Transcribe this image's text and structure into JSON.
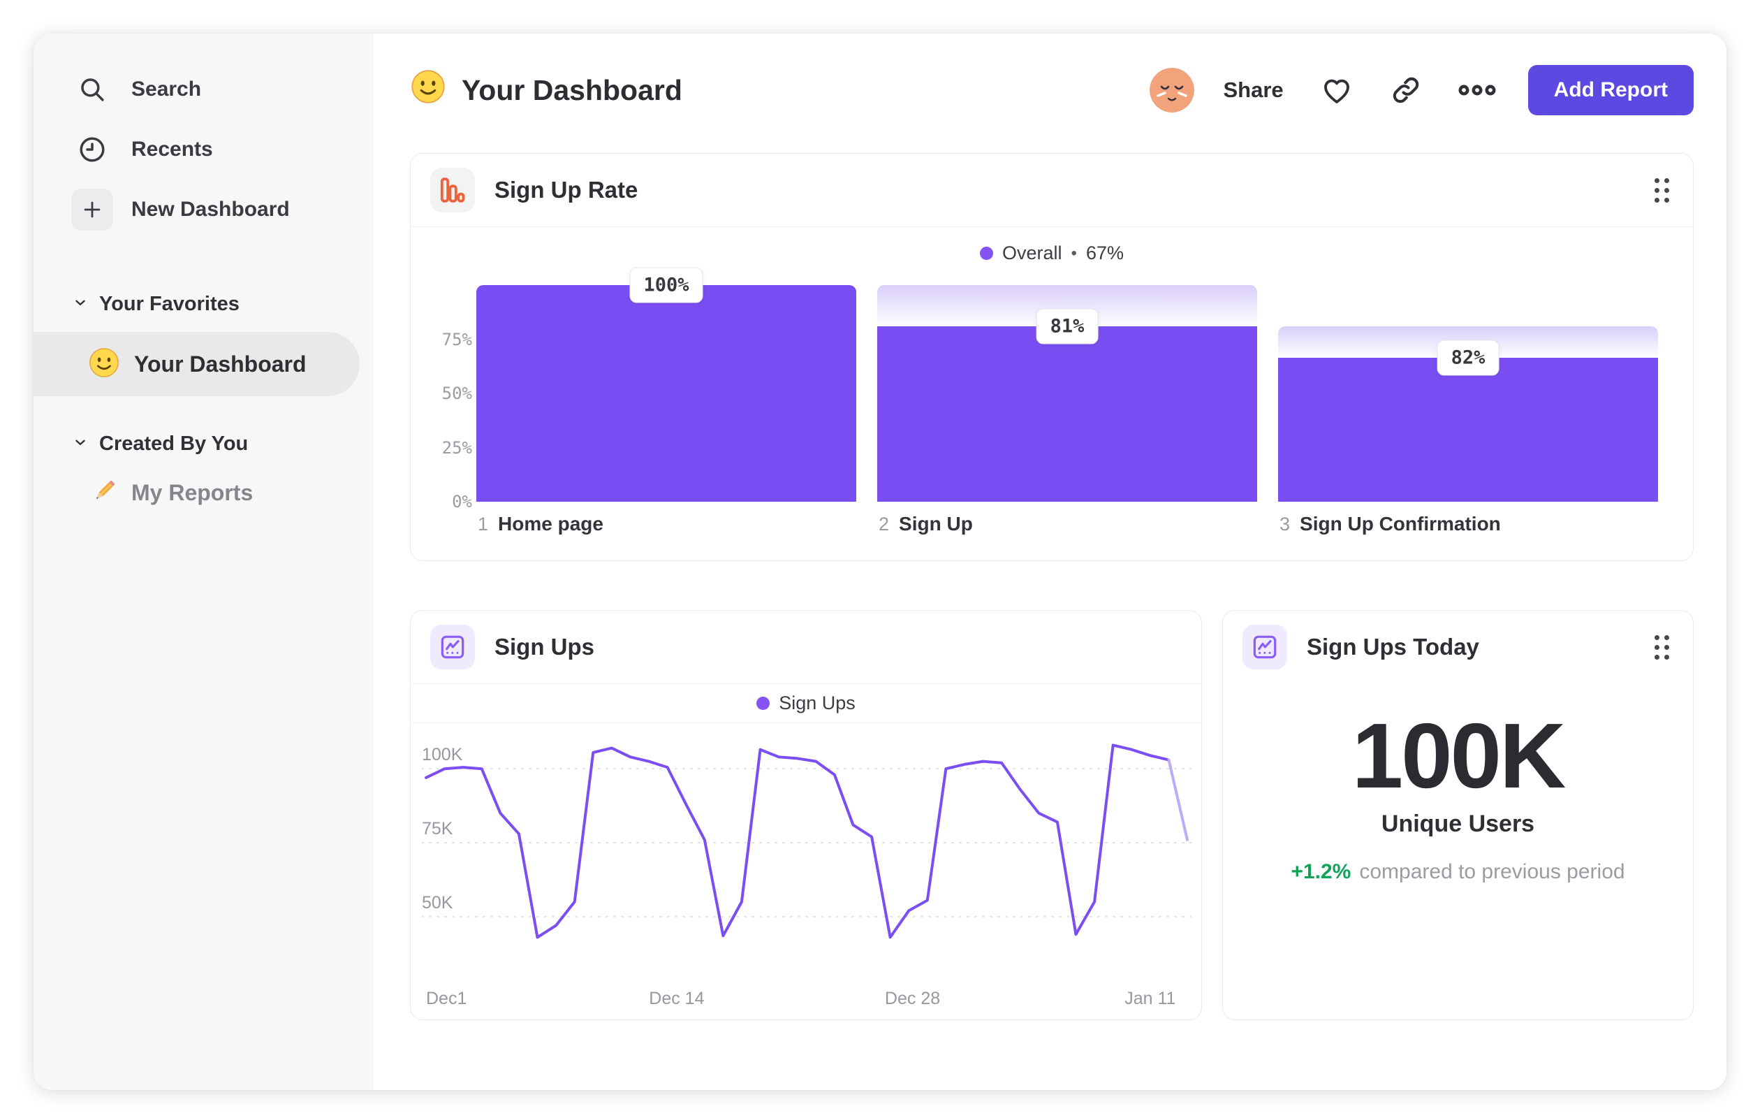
{
  "theme": {
    "accent_purple": "#7a4ef2",
    "legend_dot": "#8552f5",
    "button_indigo": "#5b49e2",
    "positive_green": "#0fa35a",
    "funnel_icon_orange": "#ee6239",
    "line_icon_purple": "#8b5cf6",
    "ghost_gradient_top": "#d9cffa",
    "faded_line": "#bfaaf7"
  },
  "sidebar": {
    "items": [
      {
        "icon": "search-icon",
        "label": "Search"
      },
      {
        "icon": "clock-icon",
        "label": "Recents"
      },
      {
        "icon": "plus-icon",
        "label": "New Dashboard"
      }
    ],
    "favorites": {
      "label": "Your Favorites",
      "item": {
        "emoji": "smiley-emoji",
        "label": "Your Dashboard"
      }
    },
    "created": {
      "label": "Created By You",
      "item": {
        "emoji": "pencil-emoji",
        "label": "My Reports"
      }
    }
  },
  "header": {
    "title": "Your Dashboard",
    "share_label": "Share",
    "add_report_label": "Add Report"
  },
  "cards": {
    "funnel": {
      "title": "Sign Up Rate",
      "legend": {
        "name": "Overall",
        "separator": "•",
        "value": "67%"
      }
    },
    "line": {
      "title": "Sign Ups",
      "legend": {
        "name": "Sign Ups"
      }
    },
    "stat": {
      "title": "Sign Ups Today",
      "value": "100K",
      "label": "Unique Users",
      "delta": "+1.2%",
      "delta_note": "compared to previous period"
    }
  },
  "chart_data": [
    {
      "type": "bar",
      "variant": "funnel",
      "title": "Sign Up Rate",
      "categories": [
        "Home page",
        "Sign Up",
        "Sign Up Confirmation"
      ],
      "step_numbers": [
        "1",
        "2",
        "3"
      ],
      "values": [
        100,
        81,
        82
      ],
      "cumulative": [
        100,
        81,
        66.4
      ],
      "value_labels": [
        "100%",
        "81%",
        "82%"
      ],
      "overall_conversion": "67%",
      "unit": "%",
      "ylim": [
        0,
        100
      ],
      "yticks": [
        {
          "v": 75,
          "label": "75%"
        },
        {
          "v": 50,
          "label": "50%"
        },
        {
          "v": 25,
          "label": "25%"
        },
        {
          "v": 0,
          "label": "0%"
        }
      ],
      "legend": "Overall",
      "grid": false
    },
    {
      "type": "line",
      "title": "Sign Ups",
      "legend": "Sign Ups",
      "x_count": 41,
      "values": [
        97,
        100,
        100.5,
        100,
        85,
        78,
        43,
        47,
        55,
        105.5,
        107,
        104,
        102.5,
        100.5,
        88,
        76,
        43.5,
        55,
        106.5,
        104,
        103.5,
        102.5,
        98,
        81,
        77,
        43,
        52,
        55.5,
        100,
        101.5,
        102.5,
        102,
        93,
        85,
        82,
        44,
        55,
        108,
        106.5,
        104.5,
        103,
        76
      ],
      "values_unit": "K",
      "faded_tail_points": 2,
      "ylim": [
        36,
        114
      ],
      "yticks": [
        {
          "v": 100,
          "label": "100K"
        },
        {
          "v": 75,
          "label": "75K"
        },
        {
          "v": 50,
          "label": "50K"
        }
      ],
      "xticks": [
        {
          "pos": 0,
          "label": "Dec1",
          "anchor": "start"
        },
        {
          "pos": 13.5,
          "label": "Dec 14",
          "anchor": "middle"
        },
        {
          "pos": 26.2,
          "label": "Dec 28",
          "anchor": "middle"
        },
        {
          "pos": 39,
          "label": "Jan 11",
          "anchor": "middle"
        }
      ],
      "grid": "dotted horizontal"
    },
    {
      "type": "table",
      "variant": "stat",
      "title": "Sign Ups Today",
      "value": "100K",
      "label": "Unique Users",
      "delta": "+1.2%",
      "note": "compared to previous period"
    }
  ]
}
